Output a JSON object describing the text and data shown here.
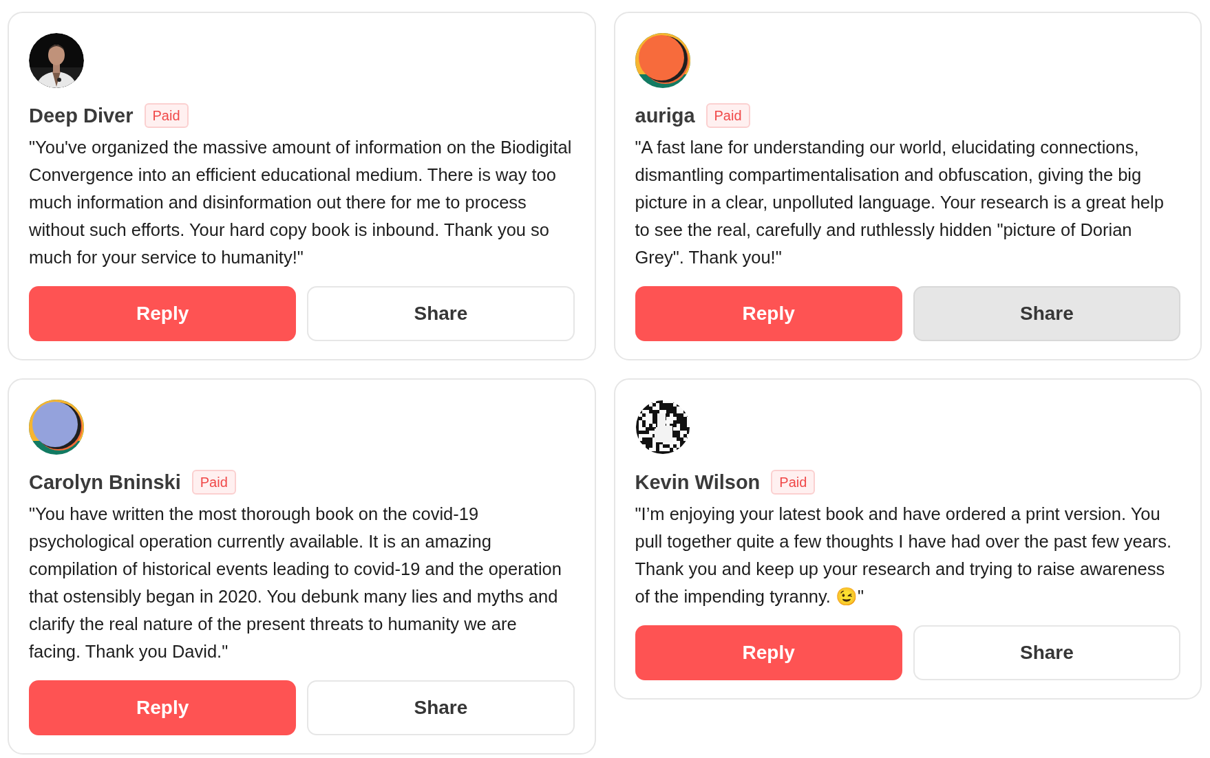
{
  "cards": [
    {
      "name": "Deep Diver",
      "badge": "Paid",
      "text": "\"You've organized the massive amount of information on the Biodigital Convergence into an efficient educational medium. There is way too much information and disinformation out there for me to process without such efforts. Your hard copy book is inbound. Thank you so much for your service to humanity!\"",
      "reply": "Reply",
      "share": {
        "label": "Share",
        "highlighted": false
      }
    },
    {
      "avatar": {
        "kind": "blob",
        "color": "#f76b3c"
      },
      "name": "auriga",
      "badge": "Paid",
      "text": "\"A fast lane for understanding our world, elucidating connections, dismantling compartimentalisation and obfuscation, giving the big picture in a clear, unpolluted language. Your research is a great help to see the real, carefully and ruthlessly hidden \"picture of Dorian Grey\". Thank you!\"",
      "reply": "Reply",
      "share": {
        "label": "Share",
        "highlighted": true
      }
    },
    {
      "avatar": {
        "kind": "blob",
        "color": "#94a2dc"
      },
      "name": "Carolyn Bninski",
      "badge": "Paid",
      "text": "\"You have written the most thorough book on the covid-19 psychological operation currently available. It is an amazing compilation of historical events leading to covid-19 and the operation that ostensibly began in 2020. You debunk many lies and myths and clarify the real nature of the present threats to humanity we are facing. Thank you David.\"",
      "reply": "Reply",
      "share": {
        "label": "Share",
        "highlighted": false
      }
    },
    {
      "avatar": {
        "kind": "pattern"
      },
      "name": "Kevin Wilson",
      "badge": "Paid",
      "text": "\"I’m enjoying your latest book and have ordered a print version. You pull together quite a few thoughts I have had over the past few years. Thank you and keep up your research and trying to raise awareness of the impending tyranny. 😉\"",
      "reply": "Reply",
      "share": {
        "label": "Share",
        "highlighted": false
      }
    }
  ]
}
